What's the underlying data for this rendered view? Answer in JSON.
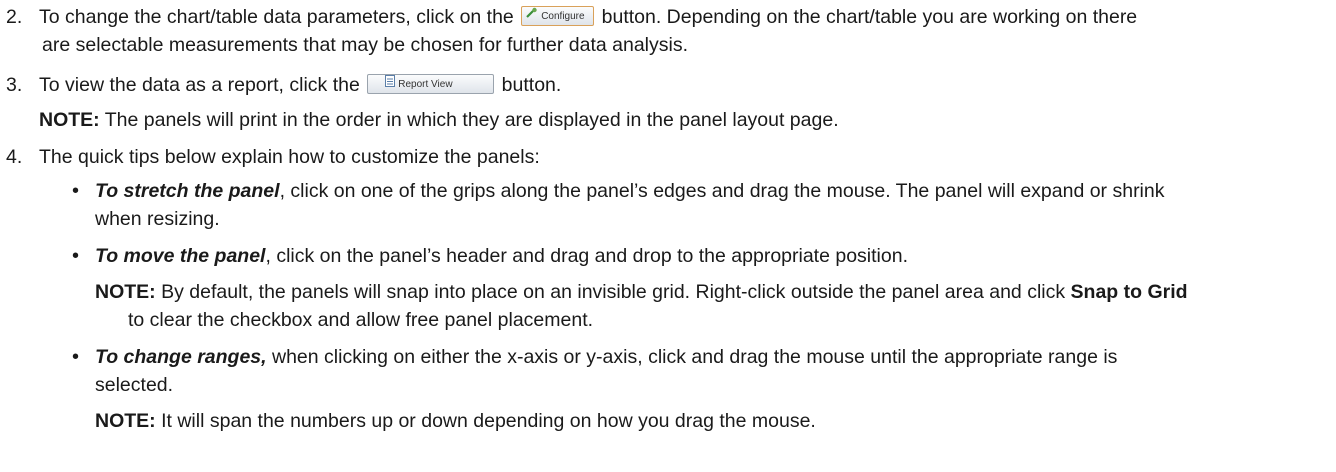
{
  "items": [
    {
      "number": "2.",
      "line1_pre": "To change the chart/table data parameters, click on the",
      "button_label": "Configure",
      "line1_post": "button. Depending on the chart/table you are working on there",
      "line2": "are selectable measurements that may be chosen for further data analysis."
    },
    {
      "number": "3.",
      "line1_pre": "To view the data as a report, click the",
      "button_label": "Report View",
      "line1_post": "button.",
      "note_label": "NOTE:",
      "note_text": "The panels will print in the order in which they are displayed in the panel layout page."
    },
    {
      "number": "4.",
      "line1": "The quick tips below explain how to customize the panels:"
    }
  ],
  "tips": [
    {
      "lead": "To stretch the panel",
      "line1": ", click on one of the grips along the panel’s edges and drag the mouse. The panel will expand or shrink",
      "line2": "when resizing."
    },
    {
      "lead": "To move the panel",
      "line1": ", click on the panel’s header and drag and drop to the appropriate position.",
      "note_label": "NOTE:",
      "note_line1_pre": "By default, the panels will snap into place on an invisible grid. Right-click outside the panel area and click",
      "note_bold": "Snap to Grid",
      "note_line2": "to clear the checkbox and allow free panel placement."
    },
    {
      "lead": "To change ranges,",
      "line1": " when clicking on either the x-axis or y-axis, click and drag the mouse until the appropriate range is",
      "line2": "selected.",
      "note_label": "NOTE:",
      "note_text": "It will span the numbers up or down depending on how you drag the mouse."
    }
  ],
  "icons": {
    "configure": "configure-icon",
    "report": "report-document-icon"
  },
  "colors": {
    "text": "#1a1a1a",
    "configure_border": "#d9a15a"
  }
}
